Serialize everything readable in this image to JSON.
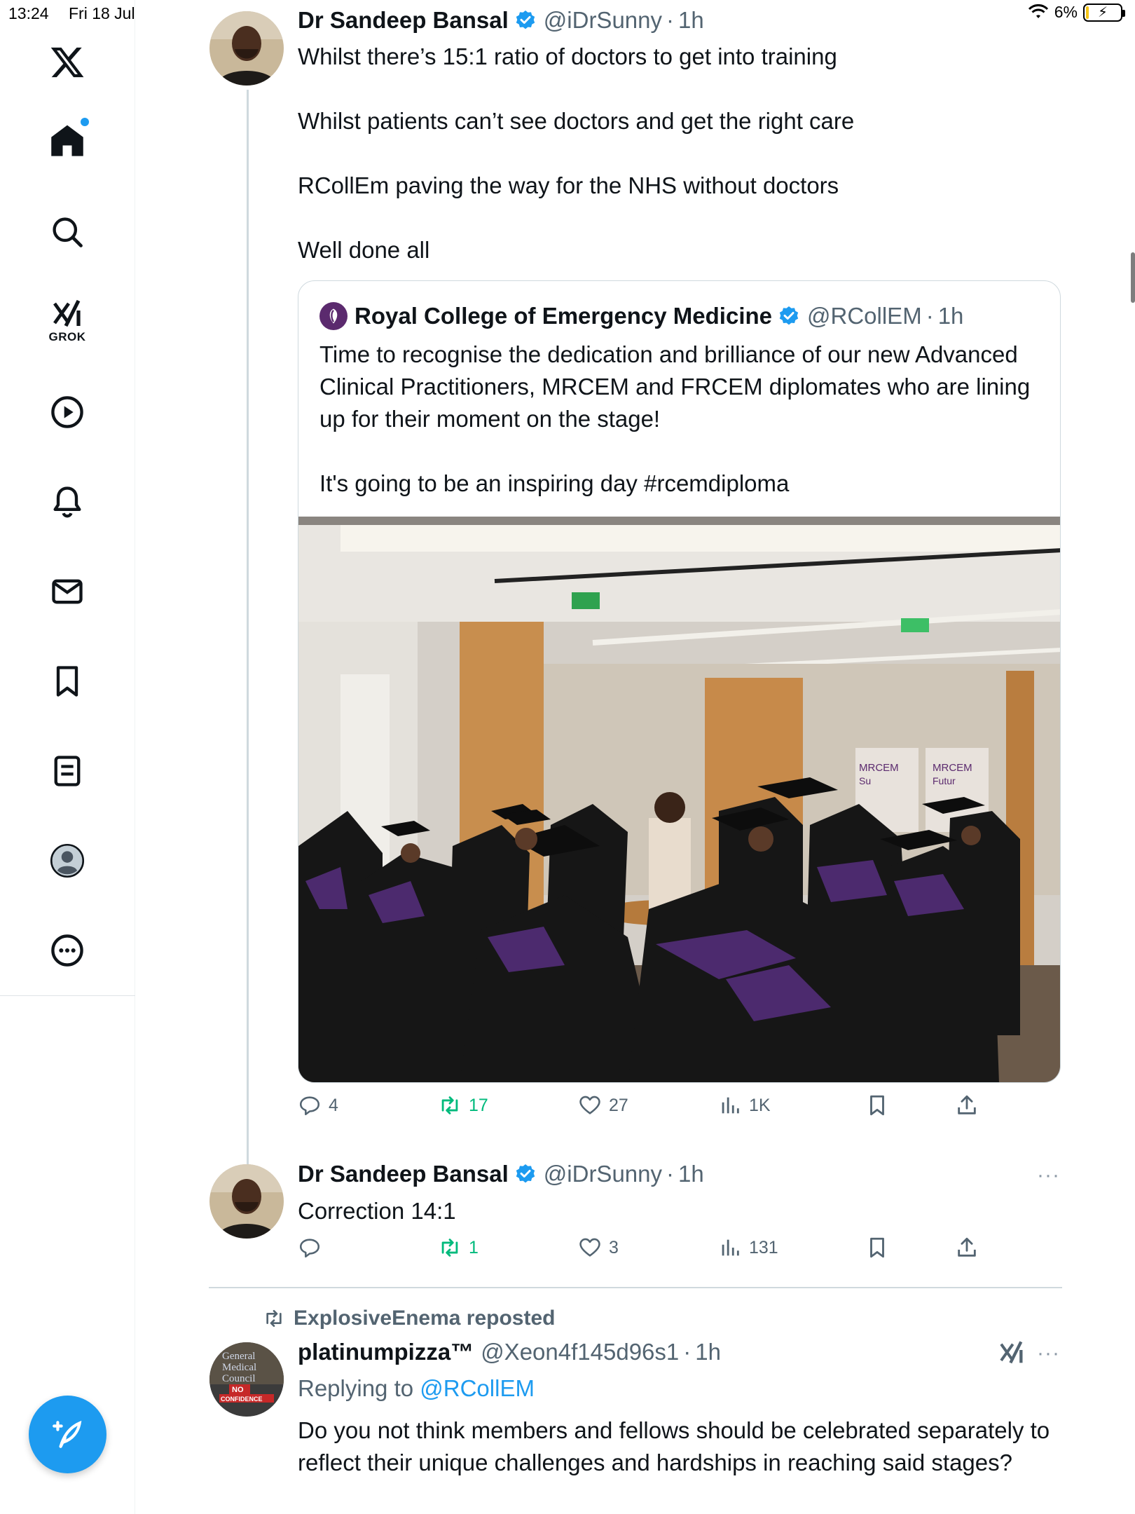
{
  "status_bar": {
    "time": "13:24",
    "date": "Fri 18 Jul",
    "battery": "6%"
  },
  "colors": {
    "accent": "#1d9bf0",
    "repost_green": "#00ba7c",
    "muted": "#536471"
  },
  "sidebar": {
    "items": [
      {
        "icon": "x-logo-icon"
      },
      {
        "icon": "home-icon",
        "notification_dot": true
      },
      {
        "icon": "search-icon"
      },
      {
        "icon": "grok-icon",
        "label": "GROK"
      },
      {
        "icon": "video-icon"
      },
      {
        "icon": "bell-icon"
      },
      {
        "icon": "mail-icon"
      },
      {
        "icon": "bookmark-icon"
      },
      {
        "icon": "lists-icon"
      },
      {
        "icon": "profile-icon"
      },
      {
        "icon": "more-icon"
      }
    ],
    "compose_icon": "compose-icon"
  },
  "tweet1": {
    "name": "Dr Sandeep Bansal",
    "handle": "@iDrSunny",
    "dot": "·",
    "time": "1h",
    "text": "Whilst there’s 15:1 ratio of doctors to get into training\n\nWhilst patients can’t see doctors and get the right care\n\nRCollEm paving the way for the NHS without doctors\n\nWell done all",
    "quote": {
      "name": "Royal College of Emergency Medicine",
      "handle": "@RCollEM",
      "dot": "·",
      "time": "1h",
      "text": "Time to recognise the dedication and brilliance of our new Advanced Clinical Practitioners, MRCEM and FRCEM diplomates who are lining up for their moment on the stage!\n\nIt's going to be an inspiring day #rcemdiploma",
      "image_signs": [
        "MRCEM",
        "MRCEM",
        "Su",
        "Futur"
      ]
    },
    "stats": {
      "replies": "4",
      "reposts": "17",
      "likes": "27",
      "views": "1K"
    }
  },
  "tweet2": {
    "name": "Dr Sandeep Bansal",
    "handle": "@iDrSunny",
    "dot": "·",
    "time": "1h",
    "text": "Correction 14:1",
    "more": "···",
    "stats": {
      "replies": "",
      "reposts": "1",
      "likes": "3",
      "views": "131"
    }
  },
  "tweet3": {
    "reposted_by": "ExplosiveEnema reposted",
    "name": "platinumpizza™",
    "handle": "@Xeon4f145d96s1",
    "dot": "·",
    "time": "1h",
    "more": "···",
    "replying_prefix": "Replying to ",
    "replying_to": "@RCollEM",
    "text": "Do you not think members and fellows should be celebrated separately to reflect their unique challenges and hardships in reaching said stages?",
    "avatar_text": [
      "General",
      "Medical",
      "Council",
      "NO",
      "CONFIDENCE"
    ]
  }
}
